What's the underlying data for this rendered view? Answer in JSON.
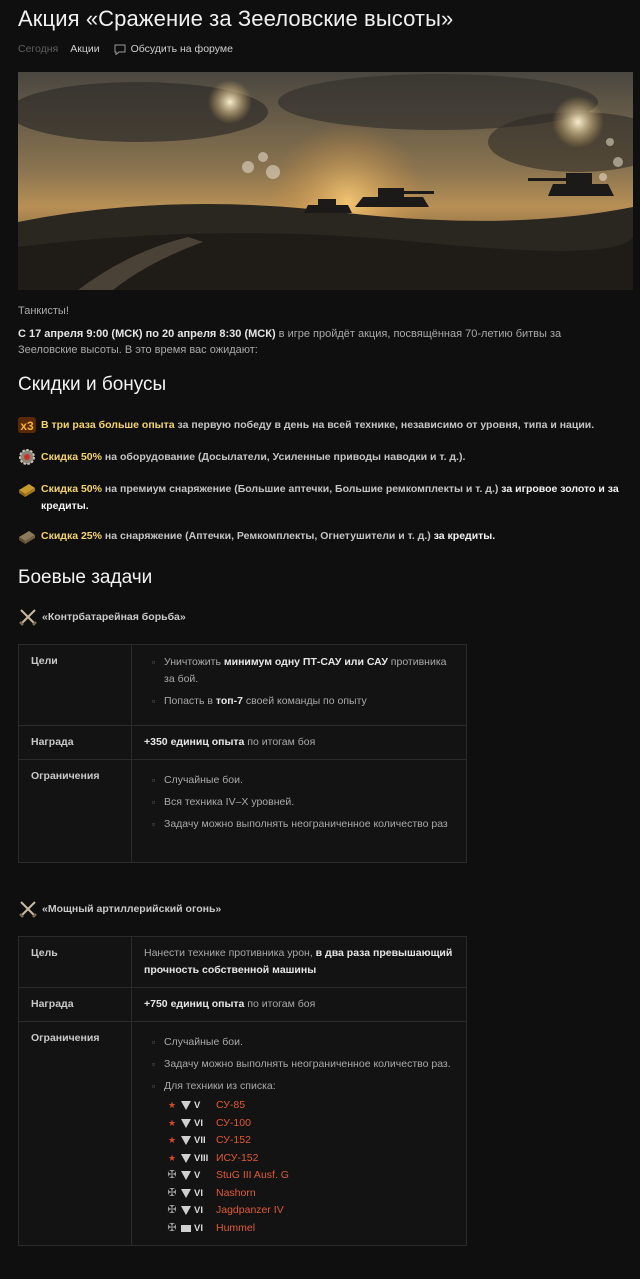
{
  "header": {
    "title": "Акция «Сражение за Зееловские высоты»",
    "date_label": "Сегодня",
    "category_label": "Акции",
    "forum_label": "Обсудить на форуме"
  },
  "intro": {
    "greeting": "Танкисты!",
    "period_bold": "С 17 апреля 9:00 (МСК) по 20 апреля 8:30 (МСК)",
    "period_text": " в игре пройдёт акция, посвящённая 70-летию битвы за Зееловские высоты. В это время вас ожидают:"
  },
  "discounts": {
    "heading": "Скидки и бонусы",
    "items": [
      {
        "icon": "x3-icon",
        "icon_text": "x3",
        "highlight": "В три раза больше опыта",
        "text": " за первую победу в день на всей технике, независимо от уровня, типа и нации."
      },
      {
        "icon": "gear-icon",
        "highlight": "Скидка 50%",
        "text": " на оборудование (Досылатели, Усиленные приводы наводки и т. д.)."
      },
      {
        "icon": "premium-ammo-icon",
        "highlight": "Скидка 50%",
        "text": " на премиум снаряжение (Большие аптечки, Большие ремкомплекты и т. д.) ",
        "tail": "за игровое золото и за кредиты."
      },
      {
        "icon": "ammo-icon",
        "highlight": "Скидка 25%",
        "text": " на снаряжение (Аптечки, Ремкомплекты, Огнетушители и т. д.) ",
        "tail": "за кредиты."
      }
    ]
  },
  "missions_heading": "Боевые задачи",
  "mission1": {
    "title": "«Контрбатарейная борьба»",
    "goals_label": "Цели",
    "goal1_a": "Уничтожить ",
    "goal1_b": "минимум одну ПТ-САУ или САУ",
    "goal1_c": " противника за бой.",
    "goal2_a": "Попасть в ",
    "goal2_b": "топ-7",
    "goal2_c": " своей команды по опыту",
    "reward_label": "Награда",
    "reward_bold": "+350 единиц опыта",
    "reward_text": " по итогам боя",
    "limits_label": "Ограничения",
    "limits": [
      "Случайные бои.",
      "Вся техника IV–X уровней.",
      "Задачу можно выполнять неограниченное количество раз"
    ]
  },
  "mission2": {
    "title": "«Мощный артиллерийский огонь»",
    "goal_label": "Цель",
    "goal_a": "Нанести технике противника урон, ",
    "goal_b": "в два раза превышающий прочность собственной машины",
    "reward_label": "Награда",
    "reward_bold": "+750 единиц опыта",
    "reward_text": " по итогам боя",
    "limits_label": "Ограничения",
    "limit1": "Случайные бои.",
    "limit2": "Задачу можно выполнять неограниченное количество раз.",
    "limit3": "Для техники из списка:",
    "tanks": [
      {
        "nation": "ussr",
        "tier": "V",
        "name": "СУ-85"
      },
      {
        "nation": "ussr",
        "tier": "VI",
        "name": "СУ-100"
      },
      {
        "nation": "ussr",
        "tier": "VII",
        "name": "СУ-152"
      },
      {
        "nation": "ussr",
        "tier": "VIII",
        "name": "ИСУ-152"
      },
      {
        "nation": "germany",
        "tier": "V",
        "name": "StuG III Ausf. G"
      },
      {
        "nation": "germany",
        "tier": "VI",
        "name": "Nashorn"
      },
      {
        "nation": "germany",
        "tier": "VI",
        "name": "Jagdpanzer IV"
      },
      {
        "nation": "germany",
        "tier": "VI",
        "name": "Hummel",
        "class": "spg"
      }
    ]
  }
}
